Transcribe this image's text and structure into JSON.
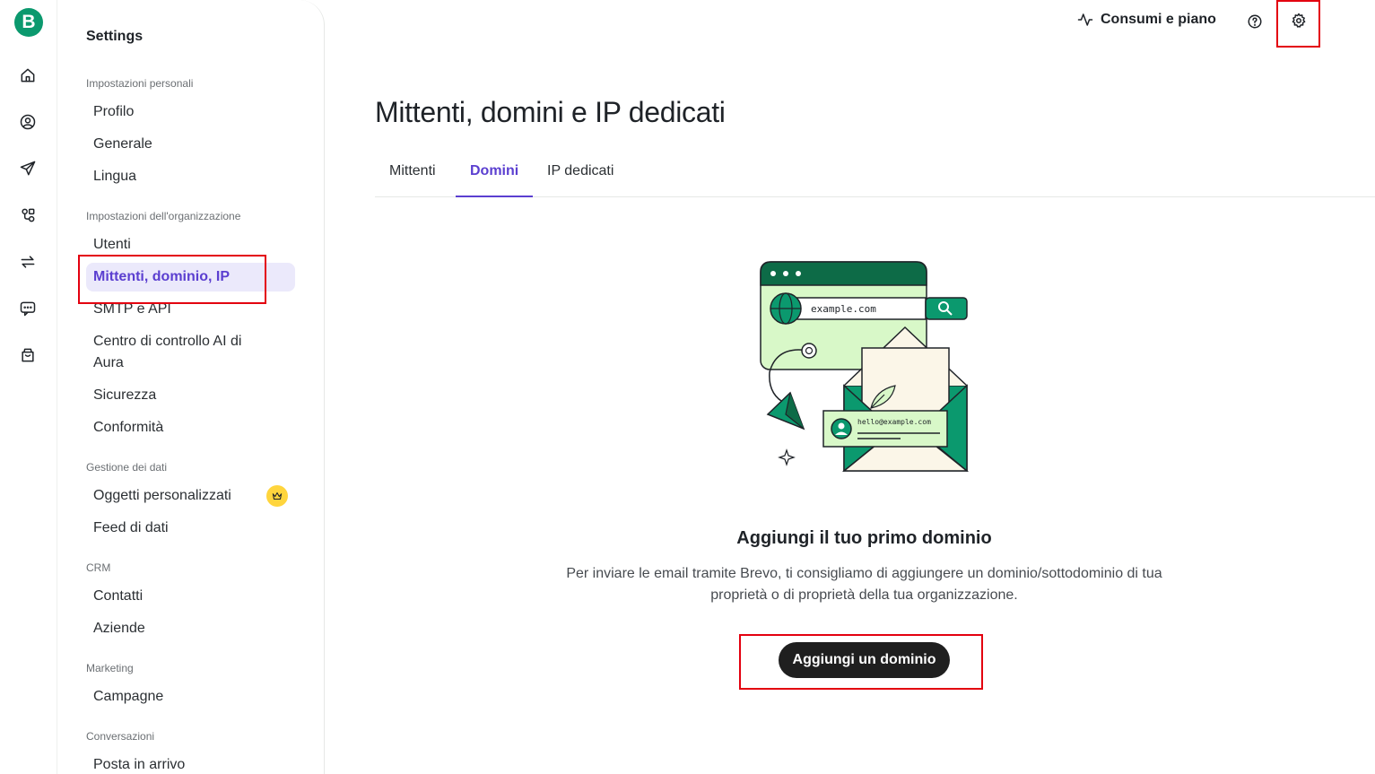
{
  "app": {
    "logo_letter": "B"
  },
  "rail": {
    "items": [
      {
        "icon": "home-icon"
      },
      {
        "icon": "contacts-icon"
      },
      {
        "icon": "campaigns-send-icon"
      },
      {
        "icon": "automations-icon"
      },
      {
        "icon": "transactional-icon"
      },
      {
        "icon": "conversations-icon"
      },
      {
        "icon": "ecommerce-icon"
      }
    ]
  },
  "sidebar": {
    "title": "Settings",
    "sections": [
      {
        "heading": "Impostazioni personali",
        "items": [
          "Profilo",
          "Generale",
          "Lingua"
        ]
      },
      {
        "heading": "Impostazioni dell'organizzazione",
        "items": [
          "Utenti",
          "Mittenti, dominio, IP",
          "SMTP e API",
          "Centro di controllo AI di Aura",
          "Sicurezza",
          "Conformità"
        ]
      },
      {
        "heading": "Gestione dei dati",
        "items": [
          "Oggetti personalizzati",
          "Feed di dati"
        ]
      },
      {
        "heading": "CRM",
        "items": [
          "Contatti",
          "Aziende"
        ]
      },
      {
        "heading": "Marketing",
        "items": [
          "Campagne"
        ]
      },
      {
        "heading": "Conversazioni",
        "items": [
          "Posta in arrivo"
        ]
      }
    ],
    "active_item": "Mittenti, dominio, IP",
    "premium_badge_icon": "crown-icon"
  },
  "header": {
    "usage_label": "Consumi e piano",
    "usage_icon": "activity-icon",
    "help_icon": "help-icon",
    "settings_icon": "gear-icon"
  },
  "main": {
    "title": "Mittenti, domini e IP dedicati",
    "tabs": [
      {
        "label": "Mittenti",
        "active": false
      },
      {
        "label": "Domini",
        "active": true
      },
      {
        "label": "IP dedicati",
        "active": false
      }
    ],
    "illustration": {
      "url_text": "example.com",
      "email_text": "hello@example.com"
    },
    "empty_state": {
      "title": "Aggiungi il tuo primo dominio",
      "description": "Per inviare le email tramite Brevo, ti consigliamo di aggiungere un dominio/sottodominio di tua proprietà o di proprietà della tua organizzazione.",
      "cta_label": "Aggiungi un dominio"
    }
  },
  "colors": {
    "brand_green": "#0b996e",
    "accent_purple": "#5b3fd0",
    "active_bg": "#ebe9fb",
    "highlight_red": "#e3000f",
    "cta_bg": "#1f1f1f"
  }
}
